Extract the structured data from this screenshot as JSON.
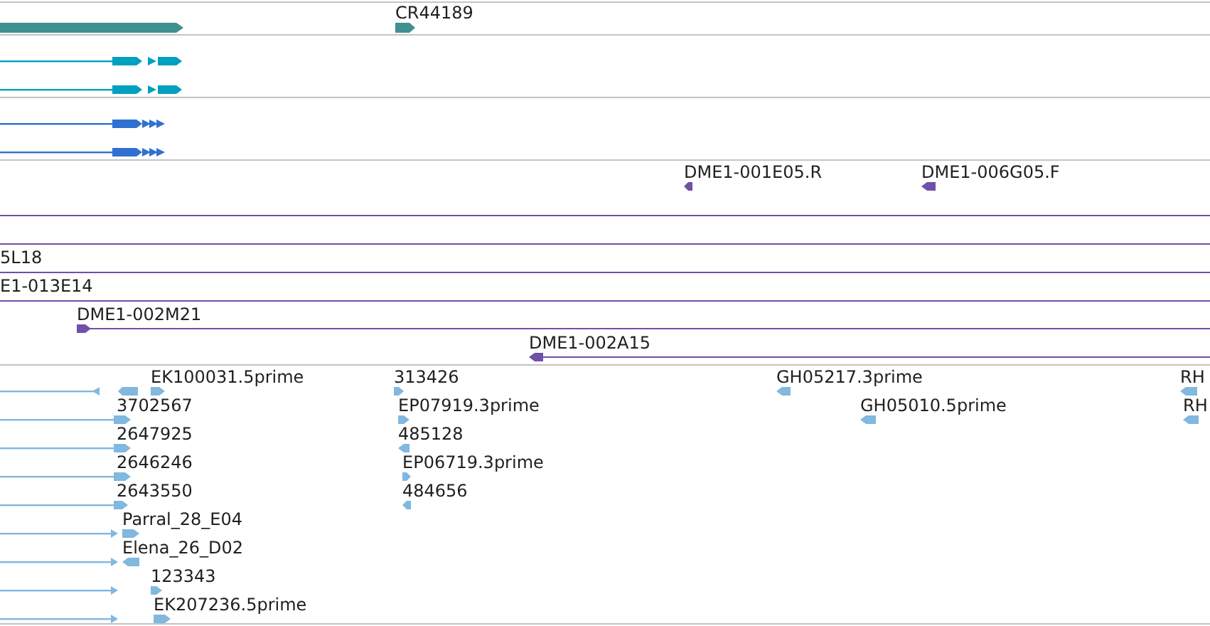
{
  "gene_track": {
    "features": [
      {
        "label": "CR44189",
        "reverse": false
      }
    ]
  },
  "bac_end_track": {
    "features": [
      {
        "label": "DME1-001E05.R",
        "reverse": true
      },
      {
        "label": "DME1-006G05.F",
        "reverse": true
      }
    ]
  },
  "bac_clone_track": {
    "features": [
      {
        "label": "5L18"
      },
      {
        "label": "E1-013E14"
      },
      {
        "label": "DME1-002M21",
        "reverse": false
      },
      {
        "label": "DME1-002A15",
        "reverse": true
      }
    ]
  },
  "est_track": {
    "features": [
      {
        "label": "EK100031.5prime",
        "reverse": false
      },
      {
        "label": "313426",
        "reverse": false
      },
      {
        "label": "GH05217.3prime",
        "reverse": true
      },
      {
        "label": "RH",
        "reverse": true
      },
      {
        "label": "3702567",
        "reverse": false
      },
      {
        "label": "EP07919.3prime",
        "reverse": false
      },
      {
        "label": "GH05010.5prime",
        "reverse": true
      },
      {
        "label": "RH",
        "reverse": true
      },
      {
        "label": "2647925",
        "reverse": false
      },
      {
        "label": "485128",
        "reverse": true
      },
      {
        "label": "2646246",
        "reverse": false
      },
      {
        "label": "EP06719.3prime",
        "reverse": false
      },
      {
        "label": "2643550",
        "reverse": false
      },
      {
        "label": "484656",
        "reverse": true
      },
      {
        "label": "Parral_28_E04",
        "reverse": false
      },
      {
        "label": "Elena_26_D02",
        "reverse": true
      },
      {
        "label": "123343",
        "reverse": false
      },
      {
        "label": "EK207236.5prime",
        "reverse": false
      }
    ]
  }
}
